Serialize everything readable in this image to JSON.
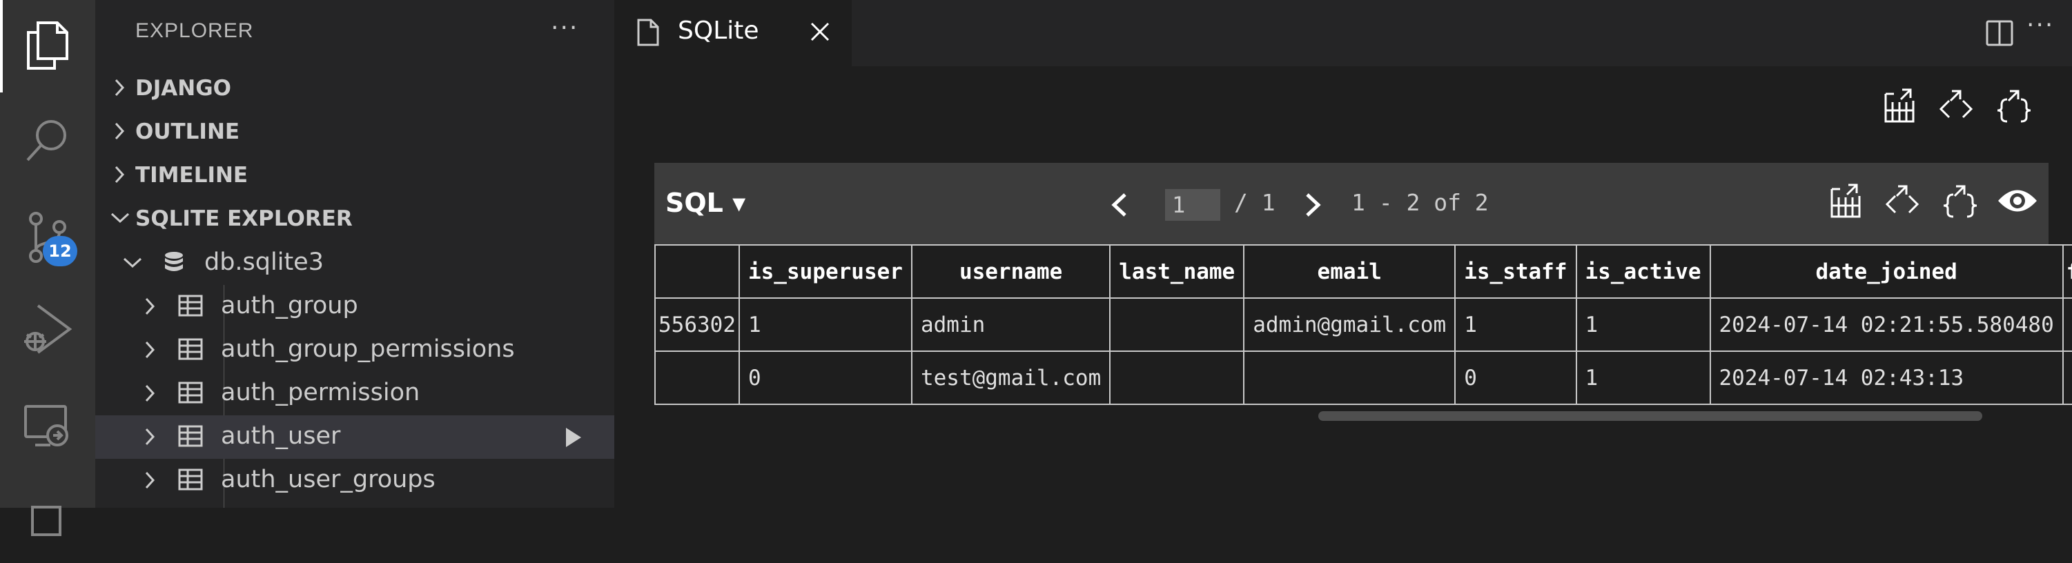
{
  "activity_bar": {
    "items": [
      "explorer-icon",
      "search-icon",
      "source-control-icon",
      "run-debug-icon",
      "remote-explorer-icon"
    ],
    "source_control_badge": "12"
  },
  "sidebar": {
    "title": "EXPLORER",
    "more": "···",
    "sections": [
      "DJANGO",
      "OUTLINE",
      "TIMELINE",
      "SQLITE EXPLORER"
    ],
    "database": "db.sqlite3",
    "tables": [
      "auth_group",
      "auth_group_permissions",
      "auth_permission",
      "auth_user",
      "auth_user_groups"
    ],
    "selected_table": "auth_user"
  },
  "editor": {
    "tab_label": "SQLite",
    "more": "···"
  },
  "viewer": {
    "sql_label": "SQL ▾",
    "page_current": "1",
    "page_total": "/ 1",
    "range": "1 - 2 of 2",
    "columns": [
      "",
      "is_superuser",
      "username",
      "last_name",
      "email",
      "is_staff",
      "is_active",
      "date_joined",
      "f"
    ],
    "rows": [
      [
        "556302",
        "1",
        "admin",
        "",
        "admin@gmail.com",
        "1",
        "1",
        "2024-07-14 02:21:55.580480",
        ""
      ],
      [
        "",
        "0",
        "test@gmail.com",
        "",
        "",
        "0",
        "1",
        "2024-07-14 02:43:13",
        ""
      ]
    ]
  },
  "colors": {
    "activity_bar": "#333333",
    "sidebar": "#252526",
    "editor": "#1e1e1e",
    "badge": "#2f7bd6",
    "selected_row": "#37373d"
  }
}
